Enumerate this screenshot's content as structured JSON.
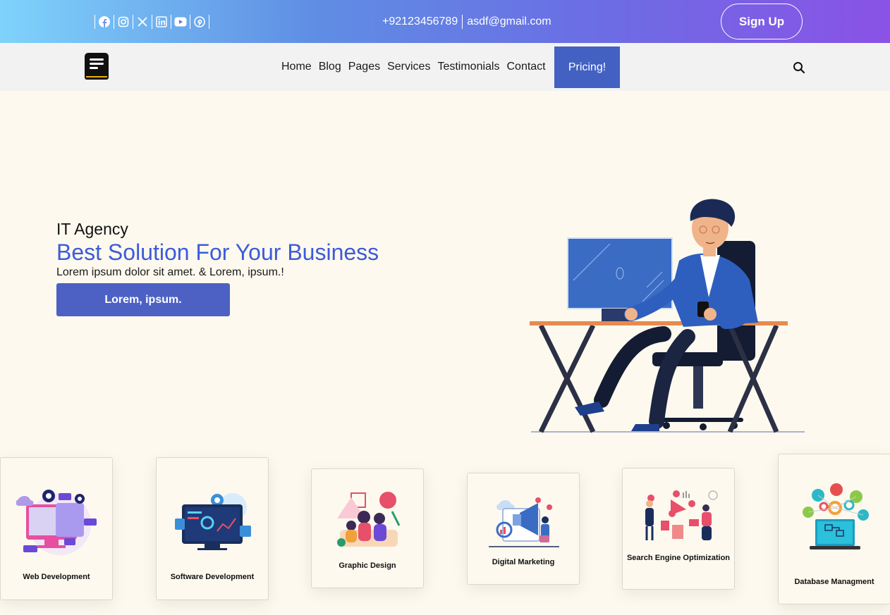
{
  "topbar": {
    "social_icons": [
      "facebook-icon",
      "instagram-icon",
      "x-icon",
      "linkedin-icon",
      "youtube-icon",
      "pinterest-icon"
    ],
    "phone": "+92123456789",
    "email": "asdf@gmail.com",
    "signup_label": "Sign Up"
  },
  "nav": {
    "items": [
      {
        "label": "Home"
      },
      {
        "label": "Blog"
      },
      {
        "label": "Pages"
      },
      {
        "label": "Services"
      },
      {
        "label": "Testimonials"
      },
      {
        "label": "Contact"
      }
    ],
    "pricing_label": "Pricing!"
  },
  "hero": {
    "eyebrow": "IT Agency",
    "headline": "Best Solution For Your Business",
    "lead": "Lorem ipsum dolor sit amet. & Lorem, ipsum.!",
    "cta_label": "Lorem, ipsum."
  },
  "services": [
    {
      "title": "Web Development"
    },
    {
      "title": "Software Development"
    },
    {
      "title": "Graphic Design"
    },
    {
      "title": "Digital Marketing"
    },
    {
      "title": "Search Engine Optimization"
    },
    {
      "title": "Database Managment"
    }
  ],
  "colors": {
    "accent": "#3d5bd9",
    "button": "#4d61c4",
    "pricing": "#4361c2",
    "gradient_start": "#7fd3fb",
    "gradient_end": "#8a52e6",
    "background": "#fdf9ee"
  }
}
